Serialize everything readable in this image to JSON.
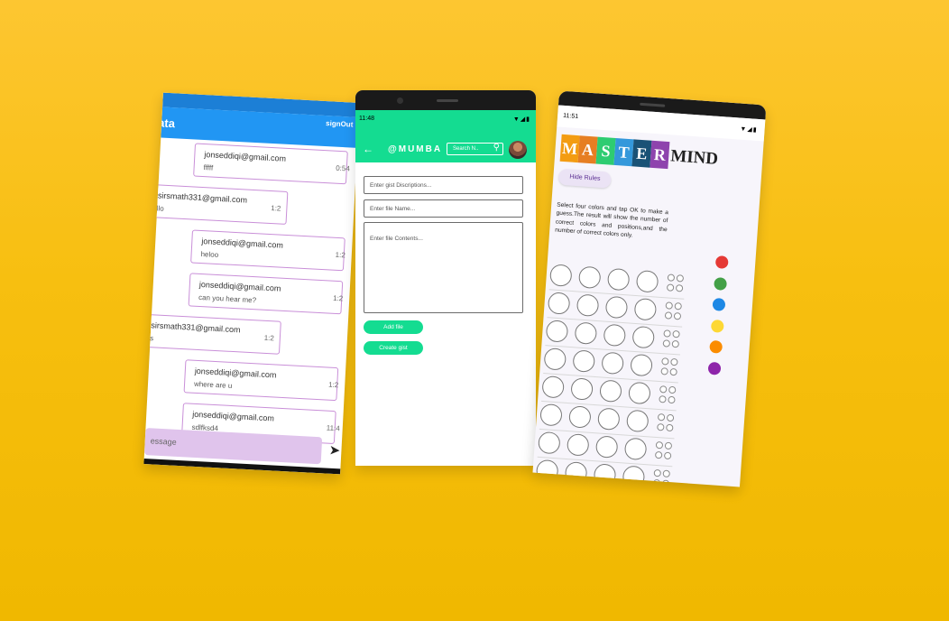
{
  "chat": {
    "title": "ata",
    "signout": "signOut",
    "messages": [
      {
        "email": "jonseddiqi@gmail.com",
        "text": "fffff",
        "time": "0:54"
      },
      {
        "email": "asirsmath331@gmail.com",
        "text": "ello",
        "time": "1:2"
      },
      {
        "email": "jonseddiqi@gmail.com",
        "text": "heloo",
        "time": "1:2"
      },
      {
        "email": "jonseddiqi@gmail.com",
        "text": "can you hear me?",
        "time": "1:2"
      },
      {
        "email": "asirsmath331@gmail.com",
        "text": "es",
        "time": "1:2"
      },
      {
        "email": "jonseddiqi@gmail.com",
        "text": "where are u",
        "time": "1:2"
      },
      {
        "email": "jonseddiqi@gmail.com",
        "text": "sdlfksd4",
        "time": "11:4"
      }
    ],
    "composer_placeholder": "essage",
    "send_icon": "send-icon"
  },
  "gist": {
    "status_time": "11:48",
    "status_icons": "▼◢▮",
    "brand": "@MUMBA",
    "search_placeholder": "Search N..",
    "back_glyph": "←",
    "search_glyph": "⚲",
    "description_placeholder": "Enter gist Discriptions...",
    "filename_placeholder": "Enter file Name...",
    "contents_placeholder": "Enter file Contents...",
    "add_file_label": "Add file",
    "create_gist_label": "Create gist",
    "accent": "#14dc91"
  },
  "mastermind": {
    "status_time": "11:51",
    "status_icons": "▼◢▮",
    "logo_letters": [
      "M",
      "A",
      "S",
      "T",
      "E",
      "R"
    ],
    "logo_colors": [
      "#f39c12",
      "#e67e22",
      "#2ecc71",
      "#3498db",
      "#1a5276",
      "#8e44ad"
    ],
    "logo_rest": "MIND",
    "hide_rules_label": "Hide Rules",
    "rules_text": "Select four colors and tap OK to make a guess.The result will show the number of correct colors and positions,and the number of correct colors only.",
    "palette_colors": [
      "#e53935",
      "#43a047",
      "#1e88e5",
      "#fdd835",
      "#fb8c00",
      "#8e24aa"
    ],
    "rows": 8
  }
}
